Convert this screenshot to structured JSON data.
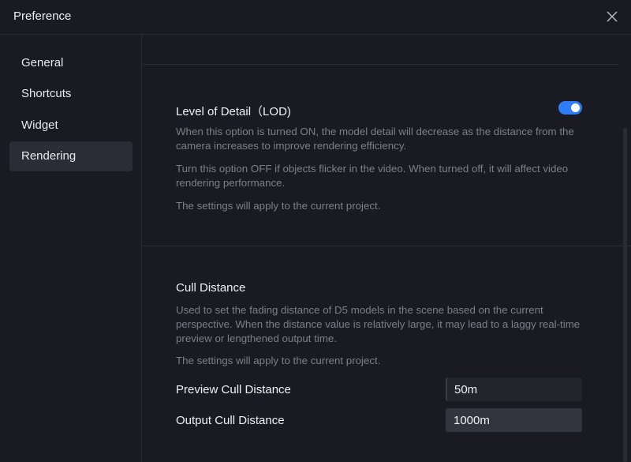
{
  "window": {
    "title": "Preference",
    "close_icon": "close-icon"
  },
  "sidebar": {
    "items": [
      {
        "label": "General",
        "active": false
      },
      {
        "label": "Shortcuts",
        "active": false
      },
      {
        "label": "Widget",
        "active": false
      },
      {
        "label": "Rendering",
        "active": true
      }
    ]
  },
  "lod": {
    "title": "Level of Detail（LOD)",
    "toggle_on": true,
    "desc1": "When this option is turned ON, the model detail will decrease as the distance from the camera increases to improve rendering efficiency.",
    "desc2": "Turn this option OFF if objects flicker in the video. When turned off, it will affect video rendering performance.",
    "desc3": "The settings will apply to the current project."
  },
  "cull": {
    "title": "Cull Distance",
    "desc1": "Used to set the fading distance of D5 models in the scene based on the current perspective. When the distance value is relatively large, it may lead to a laggy real-time preview or lengthened output time.",
    "desc2": "The settings will apply to the current project.",
    "preview_label": "Preview Cull Distance",
    "preview_value": "50m",
    "output_label": "Output Cull Distance",
    "output_value": "1000m"
  },
  "colors": {
    "accent": "#2f7df6",
    "background": "#1a1b22",
    "active_nav": "#2b2d36"
  }
}
